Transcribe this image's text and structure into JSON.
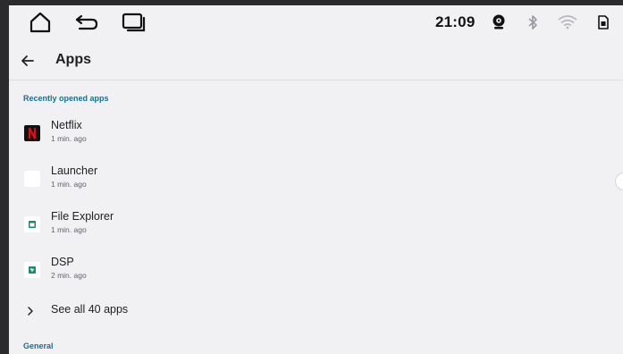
{
  "status_bar": {
    "time": "21:09",
    "nav_icons": [
      "home-icon",
      "back-arrow-icon",
      "recent-apps-icon"
    ],
    "status_icons": [
      "camera-icon",
      "bluetooth-icon",
      "wifi-icon",
      "sim-card-icon"
    ]
  },
  "app_bar": {
    "title": "Apps",
    "back_icon": "arrow-left-icon"
  },
  "recent_section": {
    "header": "Recently opened apps",
    "apps": [
      {
        "name": "Netflix",
        "time": "1 min. ago",
        "icon": "netflix-icon"
      },
      {
        "name": "Launcher",
        "time": "1 min. ago",
        "icon": "launcher-icon"
      },
      {
        "name": "File Explorer",
        "time": "1 min. ago",
        "icon": "file-explorer-icon"
      },
      {
        "name": "DSP",
        "time": "2 min. ago",
        "icon": "dsp-icon"
      }
    ],
    "see_all": "See all 40 apps"
  },
  "general_section": {
    "header": "General"
  },
  "colors": {
    "accent": "#1b6e8f",
    "background": "#f1f1f3",
    "netflix_red": "#e50914",
    "app_green": "#1a8a6e"
  }
}
